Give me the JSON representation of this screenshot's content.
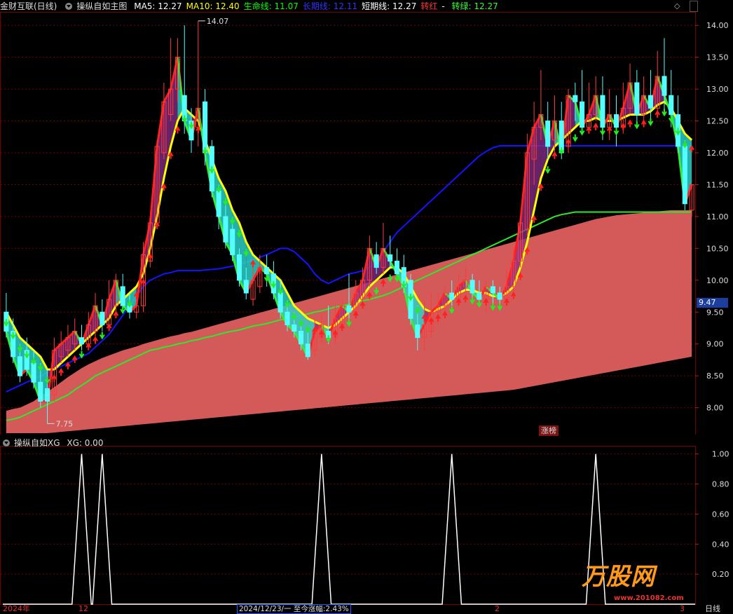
{
  "main_header": {
    "app": "金财互联(日线)",
    "indicator": "操纵自如主图",
    "items": [
      {
        "label": "MA5: 12.27",
        "color": "#ffffff"
      },
      {
        "label": "MA10: 12.40",
        "color": "#ffff00"
      },
      {
        "label": "生命线: 11.07",
        "color": "#00ff00"
      },
      {
        "label": "长期线: 12.11",
        "color": "#3333ff"
      },
      {
        "label": "短期线: 12.27",
        "color": "#ffffff"
      },
      {
        "label": "转红",
        "color": "#ff3333"
      },
      {
        "label": "- ",
        "color": "#ffffff"
      },
      {
        "label": "转绿: 12.27",
        "color": "#33ff33"
      }
    ]
  },
  "sub_header": {
    "indicator": "操纵自如XG",
    "value": "XG: 0.00"
  },
  "price_tag": "9.47",
  "zhangbang": "涨榜",
  "tooltip_date": "2024/12/23/一  至今涨幅:2.43%",
  "bottom_labels": [
    "2024年",
    "12",
    "2",
    "3"
  ],
  "period_label": "日线",
  "watermark": "万股网",
  "watermark_sub": "www.201082.com",
  "colors": {
    "up": "#ff3b3b",
    "down": "#54ffff",
    "ma_short": "#ffff00",
    "long_line": "#1414ff",
    "life_line": "#2ee82e",
    "band": "#d45a5a",
    "grid": "#7a0000"
  },
  "chart_data": [
    {
      "type": "candlestick",
      "title": "操纵自如主图",
      "ylim": [
        7.6,
        14.2
      ],
      "yticks": [
        14.0,
        13.5,
        13.0,
        12.5,
        12.0,
        11.5,
        11.0,
        10.5,
        10.0,
        9.5,
        9.0,
        8.5,
        8.0
      ],
      "ytick_labels": [
        "14.00",
        "13.50",
        "13.00",
        "12.50",
        "12.00",
        "11.50",
        "11.00",
        "10.50",
        "10.00",
        "9.50",
        "9.00",
        "8.50",
        "8.00"
      ],
      "annotations": [
        {
          "text": "14.07",
          "value": 14.07
        },
        {
          "text": "7.75",
          "value": 7.75
        }
      ],
      "candles": [
        [
          9.5,
          9.2,
          9.8,
          9.1
        ],
        [
          9.2,
          8.8,
          9.4,
          8.7
        ],
        [
          8.8,
          8.5,
          9.0,
          8.4
        ],
        [
          8.9,
          8.6,
          9.1,
          8.5
        ],
        [
          8.7,
          8.4,
          8.9,
          8.3
        ],
        [
          8.4,
          8.1,
          8.7,
          8.0
        ],
        [
          8.3,
          8.1,
          8.6,
          7.75
        ],
        [
          8.2,
          8.9,
          9.1,
          8.1
        ],
        [
          8.8,
          9.0,
          9.2,
          8.7
        ],
        [
          8.9,
          9.1,
          9.3,
          8.8
        ],
        [
          9.0,
          9.2,
          9.4,
          8.9
        ],
        [
          9.1,
          9.0,
          9.3,
          8.9
        ],
        [
          9.0,
          9.3,
          9.5,
          8.9
        ],
        [
          9.2,
          9.6,
          9.8,
          9.1
        ],
        [
          9.5,
          9.3,
          9.7,
          9.2
        ],
        [
          9.3,
          9.7,
          10.0,
          9.2
        ],
        [
          9.6,
          10.0,
          10.1,
          9.5
        ],
        [
          9.9,
          9.6,
          10.1,
          9.5
        ],
        [
          9.6,
          9.5,
          9.8,
          9.4
        ],
        [
          9.5,
          9.6,
          9.8,
          9.4
        ],
        [
          9.6,
          10.4,
          10.6,
          9.5
        ],
        [
          10.3,
          10.9,
          11.0,
          10.2
        ],
        [
          10.9,
          12.1,
          12.2,
          10.8
        ],
        [
          12.0,
          12.8,
          13.1,
          11.9
        ],
        [
          12.6,
          13.0,
          13.8,
          12.5
        ],
        [
          13.0,
          13.5,
          13.8,
          12.8
        ],
        [
          12.9,
          12.5,
          14.0,
          12.3
        ],
        [
          12.5,
          12.2,
          12.7,
          12.0
        ],
        [
          12.4,
          12.7,
          14.07,
          12.1
        ],
        [
          12.8,
          12.0,
          13.0,
          11.8
        ],
        [
          12.1,
          11.4,
          12.2,
          11.3
        ],
        [
          11.4,
          11.0,
          11.5,
          10.8
        ],
        [
          11.0,
          10.6,
          11.2,
          10.5
        ],
        [
          10.8,
          10.4,
          10.9,
          10.3
        ],
        [
          10.4,
          10.0,
          10.5,
          9.9
        ],
        [
          10.0,
          9.8,
          10.2,
          9.7
        ],
        [
          9.7,
          10.0,
          10.2,
          9.6
        ],
        [
          9.9,
          10.2,
          10.4,
          9.8
        ],
        [
          10.2,
          10.1,
          10.4,
          9.9
        ],
        [
          10.1,
          9.8,
          10.3,
          9.7
        ],
        [
          9.8,
          9.5,
          10.0,
          9.4
        ],
        [
          9.5,
          9.3,
          9.6,
          9.2
        ],
        [
          9.3,
          9.2,
          9.5,
          9.1
        ],
        [
          9.2,
          9.0,
          9.3,
          8.9
        ],
        [
          9.0,
          8.8,
          9.2,
          8.75
        ],
        [
          8.9,
          9.2,
          9.4,
          8.8
        ],
        [
          9.1,
          9.3,
          9.5,
          9.0
        ],
        [
          9.2,
          9.1,
          9.6,
          9.0
        ],
        [
          9.1,
          9.4,
          9.6,
          9.0
        ],
        [
          9.3,
          9.6,
          9.7,
          9.2
        ],
        [
          9.6,
          9.5,
          10.1,
          9.4
        ],
        [
          9.5,
          9.8,
          10.0,
          9.4
        ],
        [
          9.7,
          10.0,
          10.2,
          9.6
        ],
        [
          10.0,
          10.5,
          10.7,
          9.9
        ],
        [
          10.4,
          10.2,
          10.6,
          10.1
        ],
        [
          10.2,
          10.5,
          10.9,
          10.1
        ],
        [
          10.4,
          10.3,
          10.7,
          10.2
        ],
        [
          10.3,
          10.1,
          10.5,
          10.0
        ],
        [
          10.2,
          9.9,
          10.4,
          9.8
        ],
        [
          10.0,
          9.4,
          10.1,
          9.3
        ],
        [
          9.3,
          9.1,
          9.6,
          8.9
        ],
        [
          9.1,
          9.3,
          9.7,
          8.9
        ],
        [
          9.2,
          9.5,
          9.8,
          9.1
        ],
        [
          9.5,
          9.6,
          9.8,
          9.3
        ],
        [
          9.6,
          9.8,
          9.9,
          9.5
        ],
        [
          9.8,
          9.7,
          10.0,
          9.6
        ],
        [
          9.7,
          9.9,
          10.1,
          9.6
        ],
        [
          9.9,
          10.0,
          10.2,
          9.8
        ],
        [
          10.0,
          9.8,
          10.1,
          9.7
        ],
        [
          9.8,
          9.7,
          10.0,
          9.6
        ],
        [
          9.7,
          9.9,
          10.0,
          9.5
        ],
        [
          9.9,
          9.8,
          10.0,
          9.6
        ],
        [
          9.8,
          9.7,
          9.9,
          9.6
        ],
        [
          9.7,
          9.9,
          10.2,
          9.6
        ],
        [
          9.9,
          10.3,
          10.5,
          9.8
        ],
        [
          10.3,
          10.9,
          11.0,
          10.2
        ],
        [
          10.8,
          12.0,
          12.3,
          10.7
        ],
        [
          11.9,
          12.4,
          12.8,
          11.5
        ],
        [
          12.4,
          12.6,
          13.3,
          12.2
        ],
        [
          12.5,
          12.1,
          12.8,
          11.9
        ],
        [
          12.2,
          12.5,
          12.9,
          12.0
        ],
        [
          12.5,
          12.0,
          12.8,
          11.9
        ],
        [
          12.1,
          12.9,
          13.0,
          12.0
        ],
        [
          12.9,
          12.8,
          13.1,
          12.5
        ],
        [
          12.8,
          12.4,
          13.3,
          12.3
        ],
        [
          12.4,
          12.6,
          13.1,
          12.3
        ],
        [
          12.6,
          12.9,
          13.2,
          12.5
        ],
        [
          12.9,
          12.4,
          13.2,
          12.2
        ],
        [
          12.4,
          12.6,
          13.0,
          12.2
        ],
        [
          12.6,
          12.4,
          12.9,
          12.1
        ],
        [
          12.4,
          12.7,
          13.1,
          12.3
        ],
        [
          12.7,
          13.1,
          13.4,
          12.6
        ],
        [
          13.1,
          12.6,
          13.3,
          12.4
        ],
        [
          12.6,
          12.9,
          13.2,
          12.5
        ],
        [
          12.9,
          12.7,
          13.3,
          12.5
        ],
        [
          12.7,
          13.2,
          13.6,
          12.6
        ],
        [
          13.2,
          12.9,
          13.8,
          12.6
        ],
        [
          12.9,
          12.6,
          13.3,
          12.4
        ],
        [
          12.6,
          12.1,
          12.9,
          12.0
        ],
        [
          12.1,
          11.2,
          12.2,
          11.1
        ],
        [
          11.1,
          11.5,
          11.5,
          11.0
        ]
      ],
      "ma_short": [
        9.5,
        9.3,
        9.1,
        9.0,
        8.9,
        8.8,
        8.6,
        8.6,
        8.7,
        8.8,
        8.9,
        9.0,
        9.1,
        9.2,
        9.3,
        9.4,
        9.6,
        9.7,
        9.8,
        9.9,
        10.1,
        10.5,
        11.0,
        11.6,
        12.1,
        12.5,
        12.7,
        12.6,
        12.5,
        12.2,
        11.9,
        11.6,
        11.4,
        11.1,
        10.9,
        10.6,
        10.4,
        10.3,
        10.2,
        10.1,
        10.0,
        9.8,
        9.6,
        9.5,
        9.4,
        9.35,
        9.3,
        9.25,
        9.3,
        9.4,
        9.5,
        9.6,
        9.75,
        9.9,
        10.0,
        10.1,
        10.2,
        10.2,
        10.1,
        9.9,
        9.7,
        9.55,
        9.5,
        9.55,
        9.6,
        9.7,
        9.8,
        9.85,
        9.85,
        9.8,
        9.8,
        9.75,
        9.75,
        9.8,
        9.9,
        10.2,
        10.6,
        11.1,
        11.6,
        11.9,
        12.1,
        12.2,
        12.3,
        12.4,
        12.5,
        12.5,
        12.55,
        12.5,
        12.5,
        12.5,
        12.55,
        12.6,
        12.6,
        12.6,
        12.65,
        12.75,
        12.8,
        12.7,
        12.5,
        12.3,
        12.2
      ],
      "long_line": [
        8.25,
        8.3,
        8.35,
        8.4,
        8.45,
        8.5,
        8.55,
        8.6,
        8.65,
        8.7,
        8.75,
        8.8,
        8.85,
        8.95,
        9.05,
        9.15,
        9.3,
        9.45,
        9.6,
        9.75,
        9.9,
        10.0,
        10.05,
        10.1,
        10.12,
        10.15,
        10.15,
        10.15,
        10.15,
        10.16,
        10.17,
        10.18,
        10.2,
        10.22,
        10.25,
        10.28,
        10.32,
        10.36,
        10.4,
        10.45,
        10.5,
        10.5,
        10.45,
        10.35,
        10.25,
        10.1,
        10.0,
        9.95,
        10.0,
        10.05,
        10.1,
        10.12,
        10.15,
        10.2,
        10.3,
        10.45,
        10.6,
        10.75,
        10.85,
        10.95,
        11.05,
        11.15,
        11.25,
        11.35,
        11.45,
        11.55,
        11.65,
        11.75,
        11.85,
        11.95,
        12.02,
        12.08,
        12.11,
        12.11,
        12.11,
        12.11,
        12.11,
        12.11,
        12.11,
        12.11,
        12.11,
        12.11,
        12.11,
        12.11,
        12.11,
        12.11,
        12.11,
        12.11,
        12.11,
        12.11,
        12.11,
        12.11,
        12.11,
        12.11,
        12.11,
        12.11,
        12.11,
        12.11,
        12.11,
        12.11,
        12.11
      ],
      "life_line": [
        7.8,
        7.82,
        7.85,
        7.9,
        7.95,
        8.0,
        8.05,
        8.1,
        8.15,
        8.2,
        8.28,
        8.35,
        8.42,
        8.5,
        8.55,
        8.6,
        8.65,
        8.7,
        8.75,
        8.8,
        8.85,
        8.9,
        8.92,
        8.95,
        8.97,
        9.0,
        9.02,
        9.05,
        9.07,
        9.1,
        9.12,
        9.15,
        9.18,
        9.2,
        9.22,
        9.25,
        9.28,
        9.3,
        9.32,
        9.35,
        9.38,
        9.4,
        9.42,
        9.45,
        9.47,
        9.5,
        9.52,
        9.55,
        9.58,
        9.6,
        9.62,
        9.65,
        9.68,
        9.7,
        9.73,
        9.76,
        9.8,
        9.85,
        9.9,
        9.95,
        10.0,
        10.05,
        10.1,
        10.15,
        10.2,
        10.25,
        10.3,
        10.35,
        10.4,
        10.45,
        10.5,
        10.55,
        10.6,
        10.65,
        10.7,
        10.75,
        10.8,
        10.85,
        10.9,
        10.95,
        11.0,
        11.03,
        11.05,
        11.07,
        11.07,
        11.07,
        11.07,
        11.07,
        11.07,
        11.07,
        11.07,
        11.07,
        11.07,
        11.07,
        11.07,
        11.07,
        11.07,
        11.07,
        11.07,
        11.07,
        11.07
      ],
      "band_top": [
        7.95,
        7.98,
        8.0,
        8.05,
        8.1,
        8.18,
        8.25,
        8.32,
        8.4,
        8.48,
        8.55,
        8.62,
        8.68,
        8.73,
        8.78,
        8.82,
        8.86,
        8.9,
        8.93,
        8.96,
        9.0,
        9.03,
        9.06,
        9.09,
        9.12,
        9.14,
        9.17,
        9.19,
        9.22,
        9.25,
        9.28,
        9.31,
        9.34,
        9.37,
        9.4,
        9.43,
        9.46,
        9.49,
        9.52,
        9.55,
        9.58,
        9.61,
        9.64,
        9.67,
        9.7,
        9.73,
        9.76,
        9.79,
        9.82,
        9.85,
        9.88,
        9.91,
        9.94,
        9.97,
        10.0,
        10.03,
        10.06,
        10.09,
        10.12,
        10.15,
        10.18,
        10.21,
        10.24,
        10.27,
        10.3,
        10.33,
        10.36,
        10.39,
        10.42,
        10.45,
        10.48,
        10.51,
        10.54,
        10.57,
        10.6,
        10.63,
        10.66,
        10.69,
        10.72,
        10.75,
        10.78,
        10.81,
        10.84,
        10.87,
        10.9,
        10.93,
        10.96,
        10.98,
        11.0,
        11.02,
        11.03,
        11.04,
        11.05,
        11.06,
        11.07,
        11.08,
        11.09,
        11.1,
        11.1,
        11.1,
        11.1
      ],
      "band_bottom": [
        7.6,
        7.6,
        7.6,
        7.6,
        7.6,
        7.6,
        7.6,
        7.61,
        7.62,
        7.63,
        7.64,
        7.65,
        7.66,
        7.67,
        7.68,
        7.69,
        7.7,
        7.71,
        7.72,
        7.73,
        7.74,
        7.75,
        7.76,
        7.77,
        7.78,
        7.79,
        7.8,
        7.81,
        7.82,
        7.83,
        7.84,
        7.85,
        7.86,
        7.87,
        7.88,
        7.89,
        7.9,
        7.91,
        7.92,
        7.93,
        7.94,
        7.95,
        7.96,
        7.97,
        7.98,
        7.99,
        8.0,
        8.01,
        8.02,
        8.03,
        8.04,
        8.05,
        8.06,
        8.07,
        8.08,
        8.09,
        8.1,
        8.11,
        8.12,
        8.13,
        8.14,
        8.15,
        8.16,
        8.17,
        8.18,
        8.19,
        8.2,
        8.21,
        8.22,
        8.23,
        8.24,
        8.25,
        8.26,
        8.27,
        8.28,
        8.3,
        8.32,
        8.34,
        8.36,
        8.38,
        8.4,
        8.42,
        8.44,
        8.46,
        8.48,
        8.5,
        8.52,
        8.54,
        8.56,
        8.58,
        8.6,
        8.62,
        8.64,
        8.66,
        8.68,
        8.7,
        8.72,
        8.74,
        8.76,
        8.78,
        8.8
      ]
    },
    {
      "type": "line",
      "title": "操纵自如XG",
      "ylim": [
        0,
        1.05
      ],
      "yticks": [
        1.0,
        0.8,
        0.6,
        0.4,
        0.2
      ],
      "ytick_labels": [
        "1.00",
        "0.80",
        "0.60",
        "0.40",
        "0.20"
      ],
      "signal_indices": [
        11,
        14,
        46,
        65,
        86
      ],
      "signal_value": 1.0
    }
  ]
}
